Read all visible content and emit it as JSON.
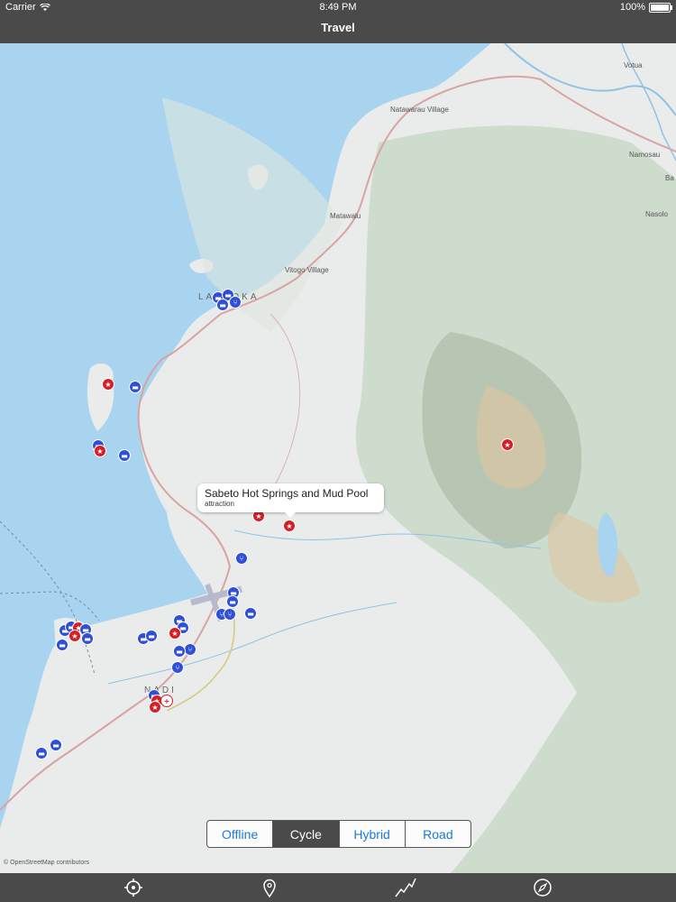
{
  "status_bar": {
    "carrier": "Carrier",
    "time": "8:49 PM",
    "battery": "100%"
  },
  "nav": {
    "title": "Travel"
  },
  "map": {
    "place_labels": {
      "votua": "Votua",
      "natawarau": "Natawarau Village",
      "namosau": "Namosau",
      "ba": "Ba",
      "nasolo": "Nasolo",
      "matawalu": "Matawalu",
      "vitogo": "Vitogo Village",
      "lautoka": "LAUTOKA",
      "nadi": "NADI"
    },
    "callout": {
      "title": "Sabeto Hot Springs and Mud Pool",
      "subtitle": "attraction"
    },
    "attribution": "© OpenStreetMap contributors",
    "colors": {
      "water": "#a8d4f0",
      "land": "#e9ecea",
      "forest": "#c9d8c9",
      "road": "#d9a3a3",
      "poi_blue": "#2f4fd8",
      "poi_red": "#d32026"
    }
  },
  "map_type_control": {
    "options": [
      "Offline",
      "Cycle",
      "Hybrid",
      "Road"
    ],
    "selected": "Cycle"
  },
  "tab_bar": {
    "items": [
      "locate-icon",
      "pin-icon",
      "route-icon",
      "compass-icon"
    ]
  }
}
